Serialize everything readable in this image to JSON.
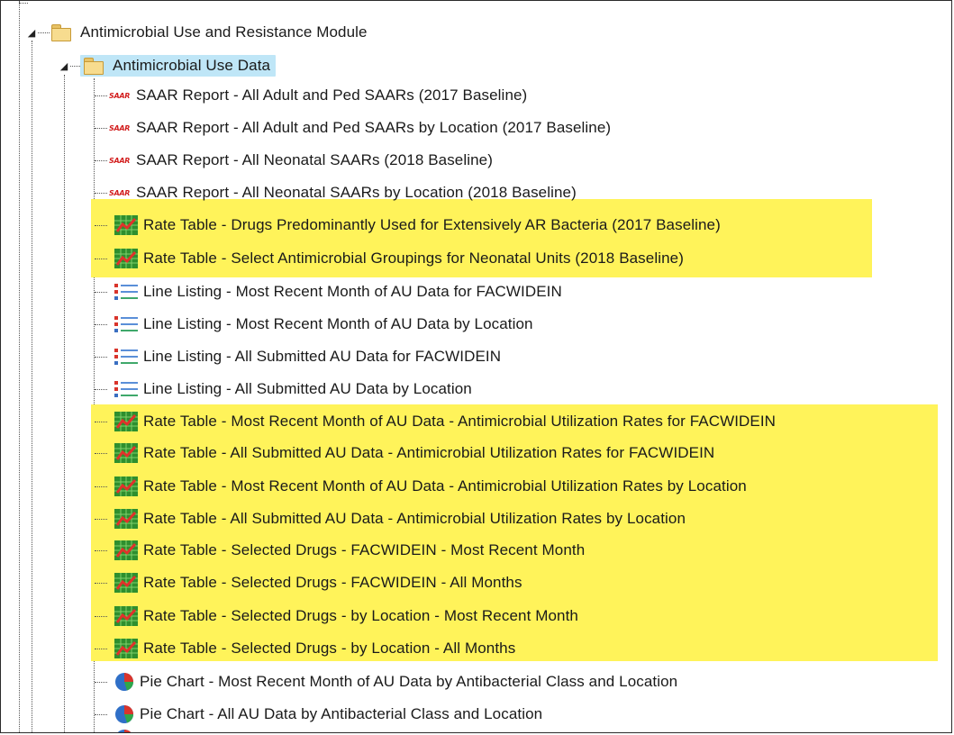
{
  "tree": {
    "module_label": "Antimicrobial Use and Resistance Module",
    "folder_label": "Antimicrobial Use Data",
    "items": [
      {
        "label": "SAAR Report - All Adult and Ped SAARs (2017 Baseline)",
        "icon": "saar-icon"
      },
      {
        "label": "SAAR Report - All Adult and Ped SAARs by Location (2017 Baseline)",
        "icon": "saar-icon"
      },
      {
        "label": "SAAR Report - All Neonatal SAARs (2018 Baseline)",
        "icon": "saar-icon"
      },
      {
        "label": "SAAR Report - All Neonatal SAARs by Location (2018 Baseline)",
        "icon": "saar-icon"
      },
      {
        "label": "Rate Table - Drugs Predominantly Used for Extensively AR Bacteria (2017 Baseline)",
        "icon": "rate-table-icon"
      },
      {
        "label": "Rate Table - Select Antimicrobial Groupings for Neonatal Units (2018 Baseline)",
        "icon": "rate-table-icon"
      },
      {
        "label": "Line Listing - Most Recent Month of AU Data for FACWIDEIN",
        "icon": "line-listing-icon"
      },
      {
        "label": "Line Listing - Most Recent Month of AU Data by Location",
        "icon": "line-listing-icon"
      },
      {
        "label": "Line Listing - All Submitted AU Data for FACWIDEIN",
        "icon": "line-listing-icon"
      },
      {
        "label": "Line Listing - All Submitted AU Data by Location",
        "icon": "line-listing-icon"
      },
      {
        "label": "Rate Table - Most Recent Month of AU Data - Antimicrobial Utilization Rates for FACWIDEIN",
        "icon": "rate-table-icon"
      },
      {
        "label": "Rate Table - All Submitted AU Data - Antimicrobial Utilization Rates for FACWIDEIN",
        "icon": "rate-table-icon"
      },
      {
        "label": "Rate Table - Most Recent Month of AU Data - Antimicrobial Utilization Rates by Location",
        "icon": "rate-table-icon"
      },
      {
        "label": "Rate Table - All Submitted AU Data - Antimicrobial Utilization Rates by Location",
        "icon": "rate-table-icon"
      },
      {
        "label": "Rate Table - Selected Drugs - FACWIDEIN - Most Recent Month",
        "icon": "rate-table-icon"
      },
      {
        "label": "Rate Table - Selected Drugs - FACWIDEIN - All Months",
        "icon": "rate-table-icon"
      },
      {
        "label": "Rate Table - Selected Drugs - by Location - Most Recent Month",
        "icon": "rate-table-icon"
      },
      {
        "label": "Rate Table - Selected Drugs - by Location - All Months",
        "icon": "rate-table-icon"
      },
      {
        "label": "Pie Chart - Most Recent Month of AU Data by Antibacterial Class and Location",
        "icon": "pie-chart-icon"
      },
      {
        "label": "Pie Chart - All AU Data by Antibacterial Class and Location",
        "icon": "pie-chart-icon"
      }
    ],
    "saar_icon_text": "SAAR"
  },
  "colors": {
    "highlight": "#fff35a",
    "selected_bg": "#bfe6f7",
    "folder": "#f7dc8f",
    "saar_red": "#d21e1e"
  }
}
